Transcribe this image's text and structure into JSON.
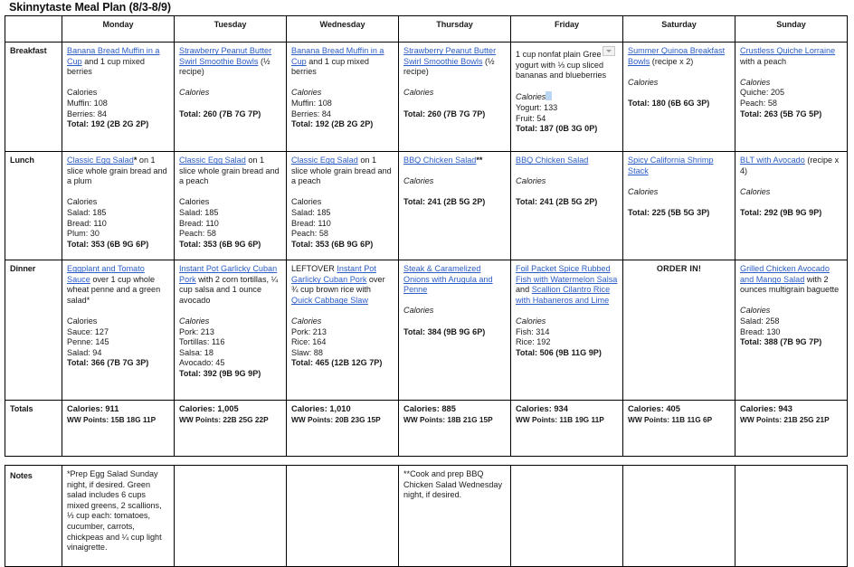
{
  "document": {
    "title": "Skinnytaste Meal Plan (8/3-8/9)"
  },
  "colors": {
    "link": "#2B5CC7",
    "text": "#1a1a1a",
    "border": "#000000",
    "selection_highlight": "#BBD6F2"
  },
  "table": {
    "corner_header": "",
    "day_headers": [
      "Monday",
      "Tuesday",
      "Wednesday",
      "Thursday",
      "Friday",
      "Saturday",
      "Sunday"
    ],
    "row_labels": {
      "breakfast": "Breakfast",
      "lunch": "Lunch",
      "dinner": "Dinner",
      "totals": "Totals",
      "notes": "Notes"
    }
  },
  "breakfast": {
    "monday": {
      "link": "Banana Bread Muffin in a Cup",
      "rest": " and 1 cup mixed berries",
      "cal_header": "Calories",
      "cal_header_italic": false,
      "lines": [
        "Muffin: 108",
        "Berries: 84"
      ],
      "total": "Total: 192 (2B 2G 2P)"
    },
    "tuesday": {
      "link": "Strawberry Peanut Butter Swirl Smoothie Bowls",
      "rest": " (½ recipe)",
      "cal_header": "Calories",
      "cal_header_italic": true,
      "lines": [],
      "total": "Total: 260 (7B 7G 7P)"
    },
    "wednesday": {
      "link": "Banana Bread Muffin in a Cup",
      "rest": " and 1 cup mixed berries",
      "cal_header": "Calories",
      "cal_header_italic": true,
      "lines": [
        "Muffin: 108",
        "Berries: 84"
      ],
      "total": "Total: 192 (2B 2G 2P)"
    },
    "thursday": {
      "link": "Strawberry Peanut Butter Swirl Smoothie Bowls",
      "rest": " (½ recipe)",
      "cal_header": "Calories",
      "cal_header_italic": true,
      "lines": [],
      "total": "Total: 260 (7B 7G 7P)"
    },
    "friday": {
      "link": "",
      "rest": "1 cup nonfat plain Gree",
      "rest2": "yogurt with ⅓ cup sliced bananas and blueberries",
      "cal_header": "Calories",
      "cal_header_italic": true,
      "lines": [
        "Yogurt: 133",
        "Fruit: 54"
      ],
      "total": "Total: 187 (0B 3G 0P)"
    },
    "saturday": {
      "link": "Summer Quinoa Breakfast Bowls",
      "rest": " (recipe x 2)",
      "cal_header": "Calories",
      "cal_header_italic": true,
      "lines": [],
      "total": "Total: 180 (6B 6G 3P)"
    },
    "sunday": {
      "link": "Crustless Quiche Lorraine",
      "rest": " with a peach",
      "cal_header": "Calories",
      "cal_header_italic": true,
      "lines": [
        "Quiche: 205",
        "Peach: 58"
      ],
      "total": "Total: 263 (5B 7G 5P)"
    }
  },
  "lunch": {
    "monday": {
      "link": "Classic Egg Salad",
      "marker": "*",
      "rest": " on 1 slice whole grain bread and a plum",
      "cal_header": "Calories",
      "cal_header_italic": false,
      "lines": [
        "Salad: 185",
        "Bread: 110",
        "Plum: 30"
      ],
      "total": "Total: 353 (6B 9G 6P)"
    },
    "tuesday": {
      "link": "Classic Egg Salad",
      "marker": "",
      "rest": " on 1 slice whole grain bread and a peach",
      "cal_header": "Calories",
      "cal_header_italic": false,
      "lines": [
        "Salad: 185",
        "Bread: 110",
        "Peach: 58"
      ],
      "total": "Total: 353 (6B 9G 6P)"
    },
    "wednesday": {
      "link": "Classic Egg Salad",
      "marker": "",
      "rest": " on 1 slice whole grain bread and a peach",
      "cal_header": "Calories",
      "cal_header_italic": false,
      "lines": [
        "Salad: 185",
        "Bread: 110",
        "Peach: 58"
      ],
      "total": "Total: 353 (6B 9G 6P)"
    },
    "thursday": {
      "link": "BBQ Chicken Salad",
      "marker": "**",
      "rest": "",
      "cal_header": "Calories",
      "cal_header_italic": true,
      "lines": [],
      "total": "Total: 241 (2B 5G 2P)"
    },
    "friday": {
      "link": "BBQ Chicken Salad",
      "marker": "",
      "rest": "",
      "cal_header": "Calories",
      "cal_header_italic": true,
      "lines": [],
      "total": "Total: 241 (2B 5G 2P)"
    },
    "saturday": {
      "link": "Spicy California Shrimp Stack",
      "marker": "",
      "rest": "",
      "cal_header": "Calories",
      "cal_header_italic": true,
      "lines": [],
      "total": "Total: 225 (5B 5G 3P)"
    },
    "sunday": {
      "link": "BLT with Avocado",
      "marker": "",
      "rest": " (recipe x 4)",
      "cal_header": "Calories",
      "cal_header_italic": true,
      "lines": [],
      "total": "Total: 292 (9B 9G 9P)"
    }
  },
  "dinner": {
    "monday": {
      "prefix": "",
      "link": "Eggplant and Tomato Sauce",
      "rest": " over 1 cup whole wheat penne and a green salad*",
      "cal_header": "Calories",
      "cal_header_italic": false,
      "lines": [
        "Sauce: 127",
        "Penne: 145",
        "Salad: 94"
      ],
      "total": "Total: 366 (7B 7G 3P)"
    },
    "tuesday": {
      "prefix": "",
      "link": "Instant Pot Garlicky Cuban Pork",
      "rest": " with 2 corn tortillas, ¼ cup salsa and 1 ounce avocado",
      "cal_header": "Calories",
      "cal_header_italic": true,
      "lines": [
        "Pork: 213",
        "Tortillas: 116",
        "Salsa: 18",
        "Avocado: 45"
      ],
      "total": "Total: 392 (9B 9G 9P)"
    },
    "wednesday": {
      "prefix": "LEFTOVER ",
      "link": "Instant Pot Garlicky Cuban Pork",
      "rest": " over ¾ cup brown rice with ",
      "link2": "Quick Cabbage Slaw",
      "cal_header": "Calories",
      "cal_header_italic": true,
      "lines": [
        "Pork: 213",
        "Rice: 164",
        "Slaw: 88"
      ],
      "total": "Total: 465 (12B 12G 7P)"
    },
    "thursday": {
      "prefix": "",
      "link": "Steak & Caramelized Onions with Arugula and Penne",
      "rest": "",
      "cal_header": "Calories",
      "cal_header_italic": true,
      "lines": [],
      "total": "Total: 384 (9B 9G 6P)"
    },
    "friday": {
      "prefix": "",
      "link": "Foil Packet Spice Rubbed Fish with Watermelon Salsa",
      "rest": " and ",
      "link2": "Scallion Cilantro Rice with Habaneros and Lime",
      "cal_header": "Calories",
      "cal_header_italic": true,
      "lines": [
        "Fish: 314",
        "Rice: 192"
      ],
      "total": "Total: 506 (9B 11G 9P)"
    },
    "saturday": {
      "order_in": "ORDER IN!"
    },
    "sunday": {
      "prefix": "",
      "link": "Grilled Chicken Avocado and Mango Salad",
      "rest": " with 2 ounces multigrain baguette",
      "cal_header": "Calories",
      "cal_header_italic": true,
      "lines": [
        "Salad: 258",
        "Bread: 130"
      ],
      "total": "Total: 388 (7B 9G 7P)"
    }
  },
  "totals": {
    "monday": {
      "calories": "Calories: 911",
      "ww": "WW Points: 15B 18G 11P"
    },
    "tuesday": {
      "calories": "Calories: 1,005",
      "ww": "WW Points: 22B 25G 22P"
    },
    "wednesday": {
      "calories": "Calories: 1,010",
      "ww": "WW Points: 20B 23G 15P"
    },
    "thursday": {
      "calories": "Calories: 885",
      "ww": "WW Points: 18B 21G 15P"
    },
    "friday": {
      "calories": "Calories: 934",
      "ww": "WW Points: 11B 19G 11P"
    },
    "saturday": {
      "calories": "Calories: 405",
      "ww": "WW Points: 11B 11G 6P"
    },
    "sunday": {
      "calories": "Calories: 943",
      "ww": "WW Points: 21B 25G 21P"
    }
  },
  "notes": {
    "monday": "*Prep Egg Salad Sunday night, if desired. Green salad includes 6 cups mixed greens, 2 scallions, ⅓ cup each: tomatoes, cucumber, carrots, chickpeas and ¼ cup light vinaigrette.",
    "tuesday": "",
    "wednesday": "",
    "thursday": "**Cook and prep BBQ Chicken Salad Wednesday night, if desired.",
    "friday": "",
    "saturday": "",
    "sunday": ""
  }
}
